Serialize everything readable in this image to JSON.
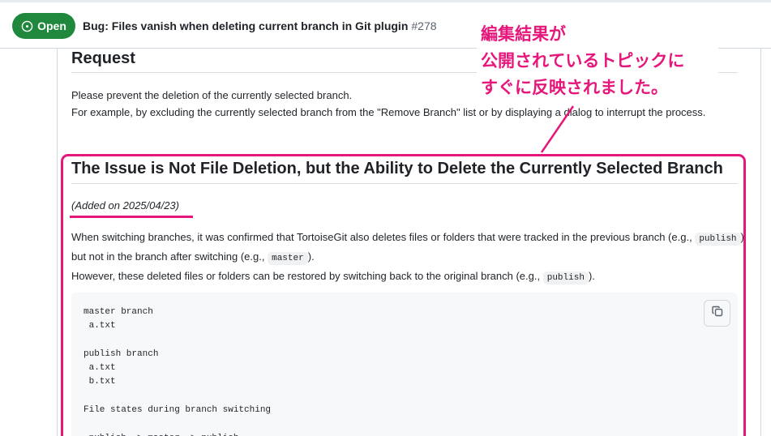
{
  "header": {
    "status_label": "Open",
    "title": "Bug: Files vanish when deleting current branch in Git plugin",
    "number": "#278"
  },
  "request": {
    "heading": "Request",
    "line1": "Please prevent the deletion of the currently selected branch.",
    "line2": "For example, by excluding the currently selected branch from the \"Remove Branch\" list or by displaying a dialog to interrupt the process."
  },
  "section": {
    "heading": "The Issue is Not File Deletion, but the Ability to Delete the Currently Selected Branch",
    "added_note": "(Added on 2025/04/23)",
    "p1_a": "When switching branches, it was confirmed that TortoiseGit also deletes files or folders that were tracked in the previous branch (e.g.,",
    "p1_code1": "publish",
    "p1_b": ") but not in the branch after switching (e.g.,",
    "p1_code2": "master",
    "p1_c": ").",
    "p2_a": "However, these deleted files or folders can be restored by switching back to the original branch (e.g.,",
    "p2_code": "publish",
    "p2_b": ").",
    "code_block": "master branch\n a.txt\n\npublish branch\n a.txt\n b.txt\n\nFile states during branch switching\n\n publish -> master -> publish"
  },
  "annotation": {
    "line1": "編集結果が",
    "line2": "公開されているトピックに",
    "line3": "すぐに反映されました。"
  },
  "icons": {
    "status": "issue-opened-icon",
    "copy": "copy-icon"
  },
  "colors": {
    "open_green": "#1f883d",
    "highlight_pink": "#e5177b"
  }
}
